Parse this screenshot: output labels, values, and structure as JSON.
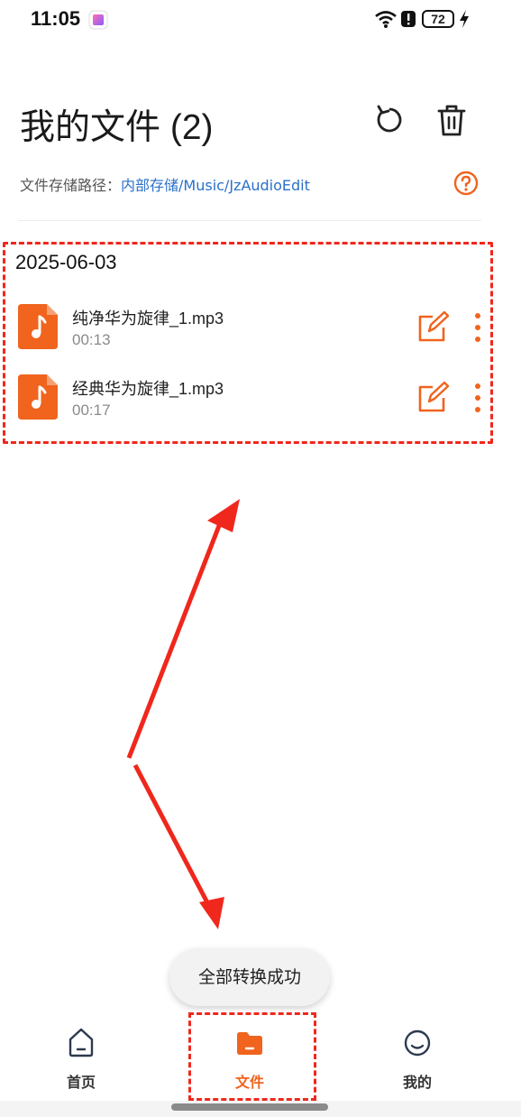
{
  "status_bar": {
    "time": "11:05",
    "battery": "72"
  },
  "header": {
    "title": "我的文件 (2)"
  },
  "storage_path": {
    "label": "文件存储路径：",
    "path": "内部存储/Music/JzAudioEdit"
  },
  "groups": [
    {
      "date": "2025-06-03",
      "files": [
        {
          "name": "纯净华为旋律_1.mp3",
          "duration": "00:13"
        },
        {
          "name": "经典华为旋律_1.mp3",
          "duration": "00:17"
        }
      ]
    }
  ],
  "toast": {
    "message": "全部转换成功"
  },
  "bottom_nav": {
    "items": [
      {
        "label": "首页",
        "icon": "home-icon",
        "active": false
      },
      {
        "label": "文件",
        "icon": "folder-icon",
        "active": true
      },
      {
        "label": "我的",
        "icon": "smile-face-icon",
        "active": false
      }
    ]
  },
  "colors": {
    "accent": "#f0641e",
    "link": "#2b70c9",
    "annotation": "#f0271c"
  }
}
